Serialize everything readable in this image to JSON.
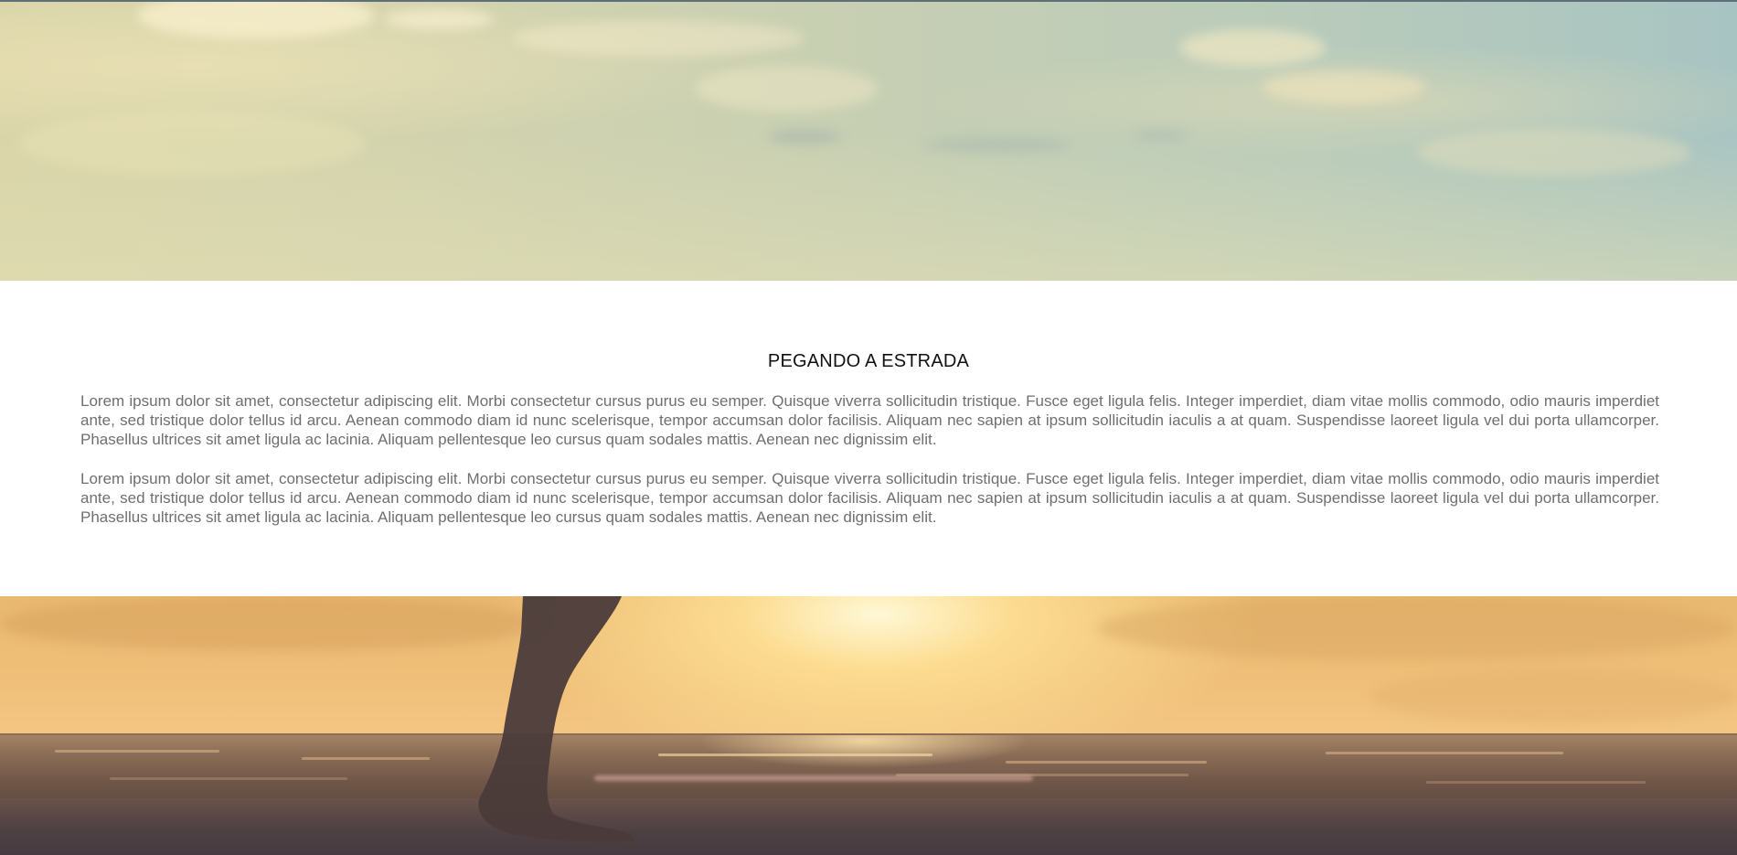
{
  "hero_top": {
    "image": "sky-clouds-banner"
  },
  "section": {
    "title": "PEGANDO A ESTRADA",
    "paragraphs": [
      "Lorem ipsum dolor sit amet, consectetur adipiscing elit. Morbi consectetur cursus purus eu semper. Quisque viverra sollicitudin tristique. Fusce eget ligula felis. Integer imperdiet, diam vitae mollis commodo, odio mauris imperdiet ante, sed tristique dolor tellus id arcu. Aenean commodo diam id nunc scelerisque, tempor accumsan dolor facilisis. Aliquam nec sapien at ipsum sollicitudin iaculis a at quam. Suspendisse laoreet ligula vel dui porta ullamcorper. Phasellus ultrices sit amet ligula ac lacinia. Aliquam pellentesque leo cursus quam sodales mattis. Aenean nec dignissim elit.",
      "Lorem ipsum dolor sit amet, consectetur adipiscing elit. Morbi consectetur cursus purus eu semper. Quisque viverra sollicitudin tristique. Fusce eget ligula felis. Integer imperdiet, diam vitae mollis commodo, odio mauris imperdiet ante, sed tristique dolor tellus id arcu. Aenean commodo diam id nunc scelerisque, tempor accumsan dolor facilisis. Aliquam nec sapien at ipsum sollicitudin iaculis a at quam. Suspendisse laoreet ligula vel dui porta ullamcorper. Phasellus ultrices sit amet ligula ac lacinia. Aliquam pellentesque leo cursus quam sodales mattis. Aenean nec dignissim elit."
    ]
  },
  "hero_bottom": {
    "image": "sunset-beach-walker-banner"
  },
  "colors": {
    "title": "#111111",
    "body_text": "#6f6f6f",
    "background": "#ffffff"
  }
}
